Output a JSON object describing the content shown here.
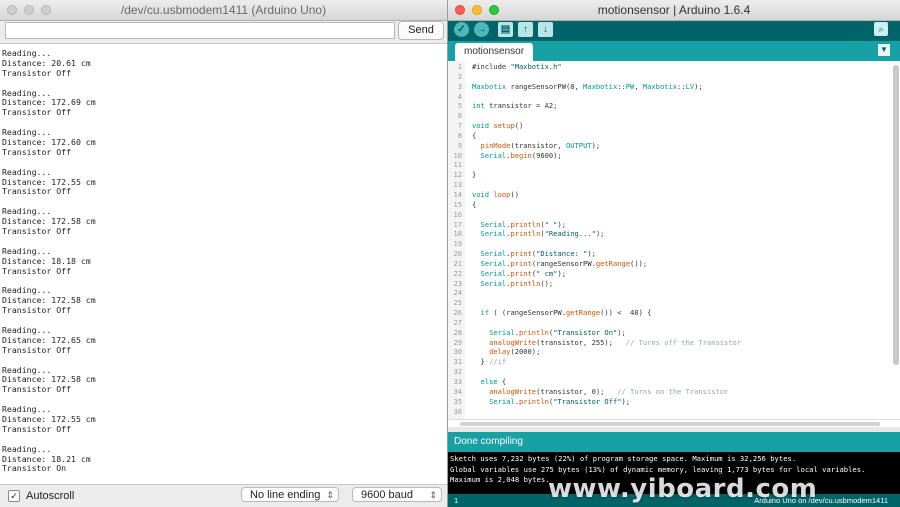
{
  "serial_monitor": {
    "title": "/dev/cu.usbmodem1411 (Arduino Uno)",
    "input_value": "",
    "send_label": "Send",
    "output_lines": [
      "Reading...",
      "Distance: 20.61 cm",
      "Transistor Off",
      "",
      "Reading...",
      "Distance: 172.69 cm",
      "Transistor Off",
      "",
      "Reading...",
      "Distance: 172.60 cm",
      "Transistor Off",
      "",
      "Reading...",
      "Distance: 172.55 cm",
      "Transistor Off",
      "",
      "Reading...",
      "Distance: 172.58 cm",
      "Transistor Off",
      "",
      "Reading...",
      "Distance: 18.18 cm",
      "Transistor Off",
      "",
      "Reading...",
      "Distance: 172.58 cm",
      "Transistor Off",
      "",
      "Reading...",
      "Distance: 172.65 cm",
      "Transistor Off",
      "",
      "Reading...",
      "Distance: 172.58 cm",
      "Transistor Off",
      "",
      "Reading...",
      "Distance: 172.55 cm",
      "Transistor Off",
      "",
      "Reading...",
      "Distance: 18.21 cm",
      "Transistor On"
    ],
    "autoscroll_label": "Autoscroll",
    "autoscroll_checked": true,
    "line_ending": "No line ending",
    "baud_rate": "9600 baud"
  },
  "ide": {
    "title": "motionsensor | Arduino 1.6.4",
    "toolbar_icons": [
      "verify-icon",
      "upload-icon",
      "new-icon",
      "open-icon",
      "save-icon",
      "serial-monitor-icon"
    ],
    "tab_label": "motionsensor",
    "code_lines": [
      "#include \"Maxbotix.h\"",
      "",
      "Maxbotix rangeSensorPW(8, Maxbotix::PW, Maxbotix::LV);",
      "",
      "int transistor = A2;",
      "",
      "void setup()",
      "{",
      "  pinMode(transistor, OUTPUT);",
      "  Serial.begin(9600);",
      "",
      "}",
      "",
      "void loop()",
      "{",
      "",
      "  Serial.println(\" \");",
      "  Serial.println(\"Reading...\");",
      "",
      "  Serial.print(\"Distance: \");",
      "  Serial.print(rangeSensorPW.getRange());",
      "  Serial.print(\" cm\");",
      "  Serial.println();",
      "",
      "",
      "  if ( (rangeSensorPW.getRange()) <  48) {",
      "",
      "    Serial.println(\"Transistor On\");",
      "    analogWrite(transistor, 255);   // Turns off the Transistor",
      "    delay(2000);",
      "  } //if",
      "",
      "  else {",
      "    analogWrite(transistor, 0);   // Turns on the Transistor",
      "    Serial.println(\"Transistor Off\");",
      ""
    ],
    "status_text": "Done compiling",
    "console_lines": [
      "Sketch uses 7,232 bytes (22%) of program storage space. Maximum is 32,256 bytes.",
      "Global variables use 275 bytes (13%) of dynamic memory, leaving 1,773 bytes for local variables.",
      "Maximum is 2,048 bytes."
    ],
    "footer_line": "1",
    "footer_board": "Arduino Uno on /dev/cu.usbmodem1411"
  },
  "watermark": "www.yiboard.com",
  "colors": {
    "ide_dark_teal": "#006468",
    "ide_tab_teal": "#17a1a5",
    "console_bg": "#000000"
  }
}
